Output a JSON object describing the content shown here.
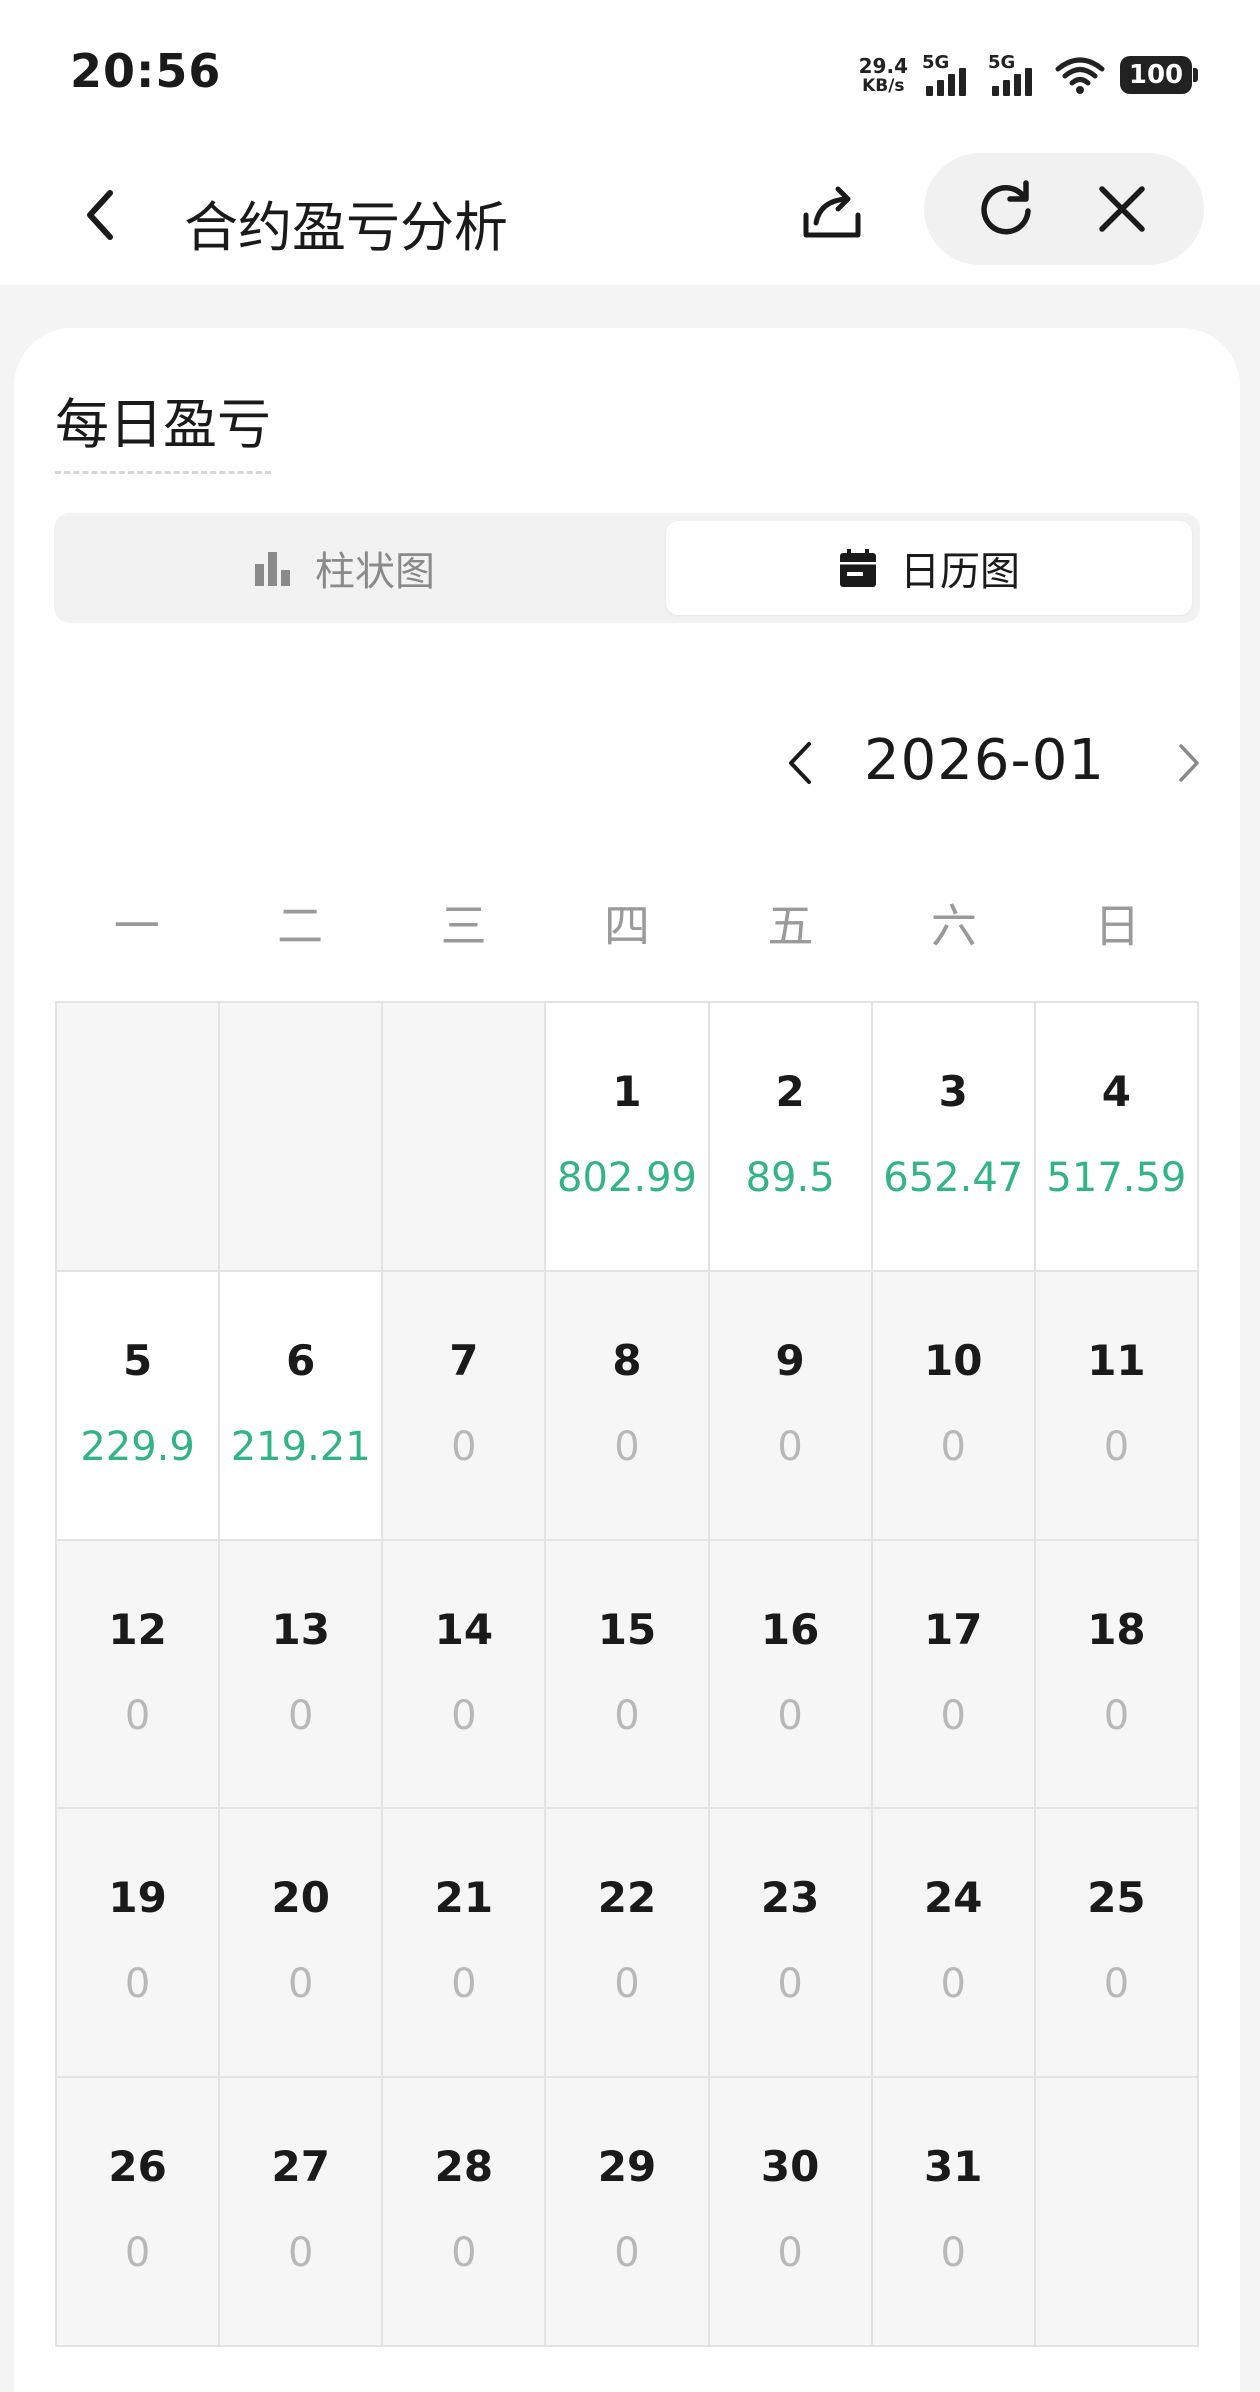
{
  "status_bar": {
    "time": "20:56",
    "net_speed_value": "29.4",
    "net_speed_unit": "KB/s",
    "sim1": "5G",
    "sim2": "5G",
    "battery": "100"
  },
  "nav": {
    "title": "合约盈亏分析",
    "icons": [
      "chevron-left-icon",
      "share-icon",
      "refresh-icon",
      "close-icon"
    ]
  },
  "card": {
    "title": "每日盈亏",
    "tabs": [
      {
        "label": "柱状图",
        "icon": "bar-chart-icon",
        "selected": false
      },
      {
        "label": "日历图",
        "icon": "calendar-icon",
        "selected": true
      }
    ],
    "month": "2026-01",
    "weekdays": [
      "一",
      "二",
      "三",
      "四",
      "五",
      "六",
      "日"
    ],
    "colors": {
      "profit": "#33b38a",
      "zero": "#b8b8b8"
    },
    "days": [
      {
        "day": "",
        "value": "",
        "active": false
      },
      {
        "day": "",
        "value": "",
        "active": false
      },
      {
        "day": "",
        "value": "",
        "active": false
      },
      {
        "day": "1",
        "value": "802.99",
        "active": true
      },
      {
        "day": "2",
        "value": "89.5",
        "active": true
      },
      {
        "day": "3",
        "value": "652.47",
        "active": true
      },
      {
        "day": "4",
        "value": "517.59",
        "active": true
      },
      {
        "day": "5",
        "value": "229.9",
        "active": true
      },
      {
        "day": "6",
        "value": "219.21",
        "active": true
      },
      {
        "day": "7",
        "value": "0",
        "active": false
      },
      {
        "day": "8",
        "value": "0",
        "active": false
      },
      {
        "day": "9",
        "value": "0",
        "active": false
      },
      {
        "day": "10",
        "value": "0",
        "active": false
      },
      {
        "day": "11",
        "value": "0",
        "active": false
      },
      {
        "day": "12",
        "value": "0",
        "active": false
      },
      {
        "day": "13",
        "value": "0",
        "active": false
      },
      {
        "day": "14",
        "value": "0",
        "active": false
      },
      {
        "day": "15",
        "value": "0",
        "active": false
      },
      {
        "day": "16",
        "value": "0",
        "active": false
      },
      {
        "day": "17",
        "value": "0",
        "active": false
      },
      {
        "day": "18",
        "value": "0",
        "active": false
      },
      {
        "day": "19",
        "value": "0",
        "active": false
      },
      {
        "day": "20",
        "value": "0",
        "active": false
      },
      {
        "day": "21",
        "value": "0",
        "active": false
      },
      {
        "day": "22",
        "value": "0",
        "active": false
      },
      {
        "day": "23",
        "value": "0",
        "active": false
      },
      {
        "day": "24",
        "value": "0",
        "active": false
      },
      {
        "day": "25",
        "value": "0",
        "active": false
      },
      {
        "day": "26",
        "value": "0",
        "active": false
      },
      {
        "day": "27",
        "value": "0",
        "active": false
      },
      {
        "day": "28",
        "value": "0",
        "active": false
      },
      {
        "day": "29",
        "value": "0",
        "active": false
      },
      {
        "day": "30",
        "value": "0",
        "active": false
      },
      {
        "day": "31",
        "value": "0",
        "active": false
      },
      {
        "day": "",
        "value": "",
        "active": false
      }
    ]
  }
}
